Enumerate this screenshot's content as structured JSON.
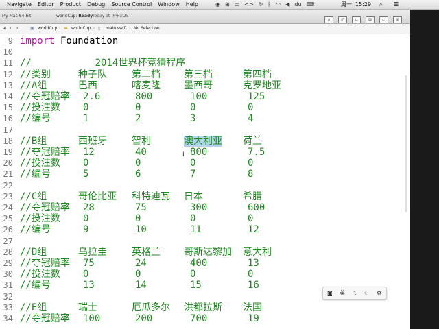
{
  "menubar": {
    "items": [
      "Navigate",
      "Editor",
      "Product",
      "Debug",
      "Source Control",
      "Window",
      "Help"
    ],
    "clock": {
      "weekday": "周一",
      "time": "15:29"
    }
  },
  "toolbar": {
    "scheme": "My Mac 64-bit",
    "project": "worldCup:",
    "status": "Ready",
    "timestamp": "Today at 下午3:25"
  },
  "jumpbar": {
    "project": "worldCup",
    "group": "worldCup",
    "file": "main.swift",
    "selection": "No Selection"
  },
  "code": {
    "lines": [
      {
        "n": "9",
        "kw": "import",
        "rest": " Foundation"
      },
      {
        "n": "10"
      },
      {
        "n": "11",
        "text": "//           2014世界杯竞猜程序"
      },
      {
        "n": "12",
        "cols": [
          "//类别",
          "种子队",
          "第二档",
          "第三档",
          "第四档"
        ]
      },
      {
        "n": "13",
        "cols": [
          "//A组",
          "巴西",
          "喀麦隆",
          "墨西哥",
          "克罗地亚"
        ]
      },
      {
        "n": "14",
        "cols": [
          "//夺冠赔率",
          "2.6",
          "800",
          "100",
          "125"
        ]
      },
      {
        "n": "15",
        "cols": [
          "//投注数",
          "0",
          "0",
          "0",
          "0"
        ]
      },
      {
        "n": "16",
        "cols": [
          "//编号",
          "1",
          "2",
          "3",
          "4"
        ]
      },
      {
        "n": "17"
      },
      {
        "n": "18",
        "cols": [
          "//B组",
          "西班牙",
          "智利",
          "澳大利亚",
          "荷兰"
        ],
        "selected": 3
      },
      {
        "n": "19",
        "cols": [
          "//夺冠赔率",
          "12",
          "40",
          "800",
          "7.5"
        ]
      },
      {
        "n": "20",
        "cols": [
          "//投注数",
          "0",
          "0",
          "0",
          "0"
        ]
      },
      {
        "n": "21",
        "cols": [
          "//编号",
          "5",
          "6",
          "7",
          "8"
        ]
      },
      {
        "n": "22"
      },
      {
        "n": "23",
        "cols": [
          "//C组",
          "哥伦比亚",
          "科特迪瓦",
          "日本",
          "希腊"
        ]
      },
      {
        "n": "24",
        "cols": [
          "//夺冠赔率",
          "28",
          "75",
          "300",
          "600"
        ]
      },
      {
        "n": "25",
        "cols": [
          "//投注数",
          "0",
          "0",
          "0",
          "0"
        ]
      },
      {
        "n": "26",
        "cols": [
          "//编号",
          "9",
          "10",
          "11",
          "12"
        ]
      },
      {
        "n": "27"
      },
      {
        "n": "28",
        "cols": [
          "//D组",
          "乌拉圭",
          "英格兰",
          "哥斯达黎加",
          "意大利"
        ]
      },
      {
        "n": "29",
        "cols": [
          "//夺冠赔率",
          "75",
          "24",
          "400",
          "13"
        ]
      },
      {
        "n": "30",
        "cols": [
          "//投注数",
          "0",
          "0",
          "0",
          "0"
        ]
      },
      {
        "n": "31",
        "cols": [
          "//编号",
          "13",
          "14",
          "15",
          "16"
        ]
      },
      {
        "n": "32"
      },
      {
        "n": "33",
        "cols": [
          "//E组",
          "瑞士",
          "厄瓜多尔",
          "洪都拉斯",
          "法国"
        ]
      },
      {
        "n": "34",
        "cols": [
          "//夺冠赔率",
          "100",
          "200",
          "700",
          "19"
        ]
      }
    ]
  },
  "ime": {
    "lang": "英"
  },
  "watermark": {
    "text": "频"
  }
}
